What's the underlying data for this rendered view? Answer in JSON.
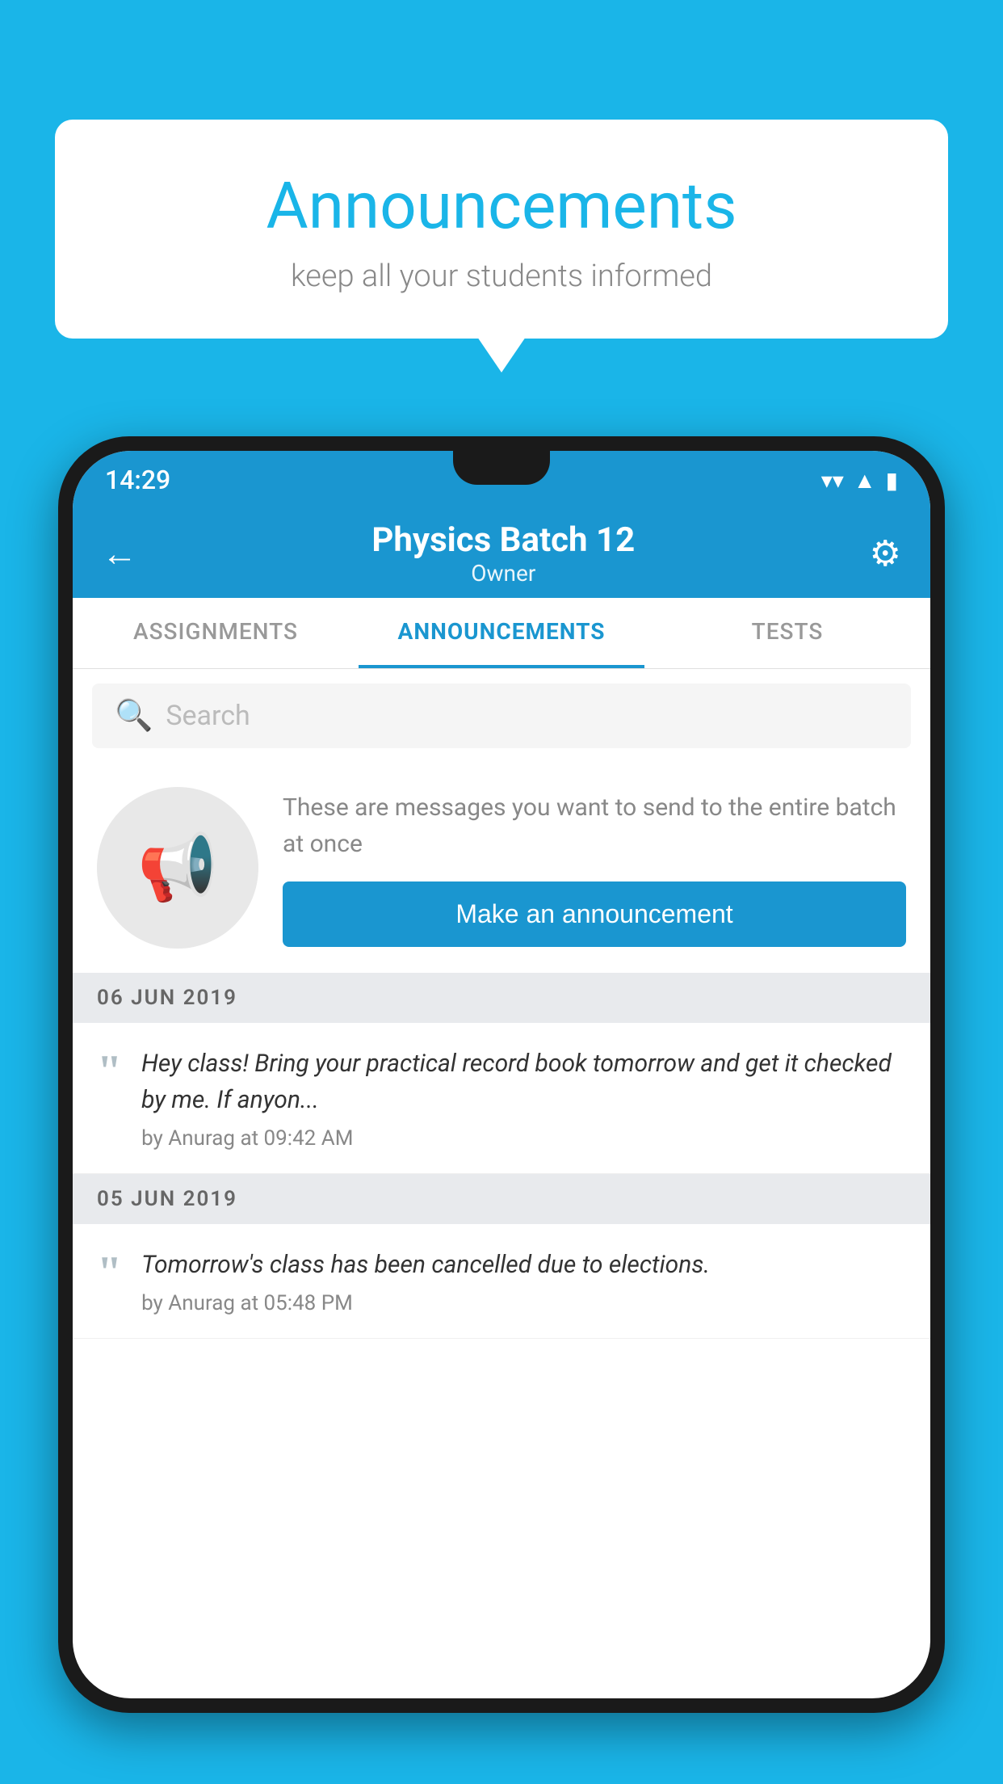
{
  "background_color": "#1ab5e8",
  "speech_bubble": {
    "title": "Announcements",
    "subtitle": "keep all your students informed"
  },
  "phone": {
    "status_bar": {
      "time": "14:29",
      "icons": [
        "wifi",
        "signal",
        "battery"
      ]
    },
    "header": {
      "title": "Physics Batch 12",
      "subtitle": "Owner",
      "back_label": "←",
      "gear_label": "⚙"
    },
    "tabs": [
      {
        "label": "ASSIGNMENTS",
        "active": false
      },
      {
        "label": "ANNOUNCEMENTS",
        "active": true
      },
      {
        "label": "TESTS",
        "active": false
      },
      {
        "label": "...",
        "active": false
      }
    ],
    "search": {
      "placeholder": "Search"
    },
    "promo": {
      "text": "These are messages you want to send to the entire batch at once",
      "button_label": "Make an announcement"
    },
    "announcements": [
      {
        "date": "06  JUN  2019",
        "text": "Hey class! Bring your practical record book tomorrow and get it checked by me. If anyon...",
        "author": "by Anurag at 09:42 AM"
      },
      {
        "date": "05  JUN  2019",
        "text": "Tomorrow's class has been cancelled due to elections.",
        "author": "by Anurag at 05:48 PM"
      }
    ]
  }
}
